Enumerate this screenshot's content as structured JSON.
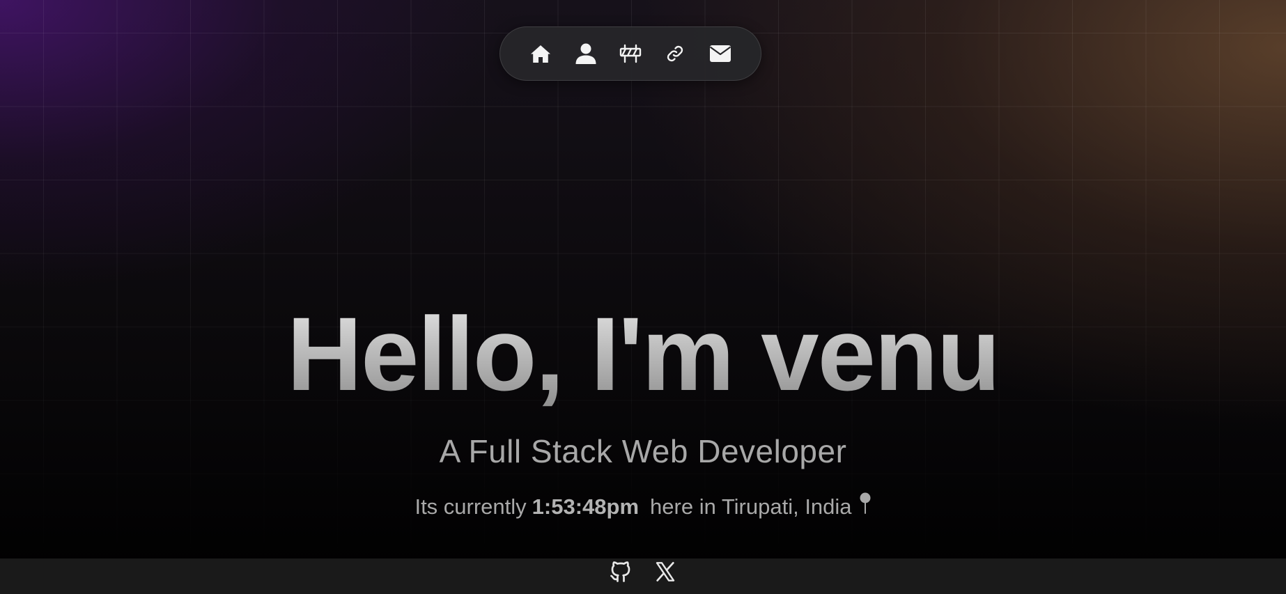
{
  "nav": {
    "items": [
      {
        "icon": "home-icon",
        "label": "Home"
      },
      {
        "icon": "user-icon",
        "label": "About"
      },
      {
        "icon": "barrier-icon",
        "label": "Projects"
      },
      {
        "icon": "link-icon",
        "label": "Links"
      },
      {
        "icon": "mail-icon",
        "label": "Contact"
      }
    ]
  },
  "hero": {
    "title": "Hello, I'm venu",
    "subtitle": "A Full Stack Web Developer",
    "time_prefix": "Its currently",
    "time_value": "1:53:48pm",
    "time_suffix": "here in Tirupati, India",
    "location_icon": "map-pin-icon"
  },
  "footer": {
    "social": [
      {
        "icon": "github-icon",
        "label": "GitHub"
      },
      {
        "icon": "x-twitter-icon",
        "label": "X"
      }
    ]
  },
  "colors": {
    "nav_bg": "#262629",
    "title_gradient_top": "#e6e6e6",
    "title_gradient_bottom": "#8e8e8e",
    "subtitle_text": "#a8a8a8",
    "footer_bg": "#1a1a1a",
    "accent_purple": "#46146e",
    "accent_brown": "#64462d"
  }
}
